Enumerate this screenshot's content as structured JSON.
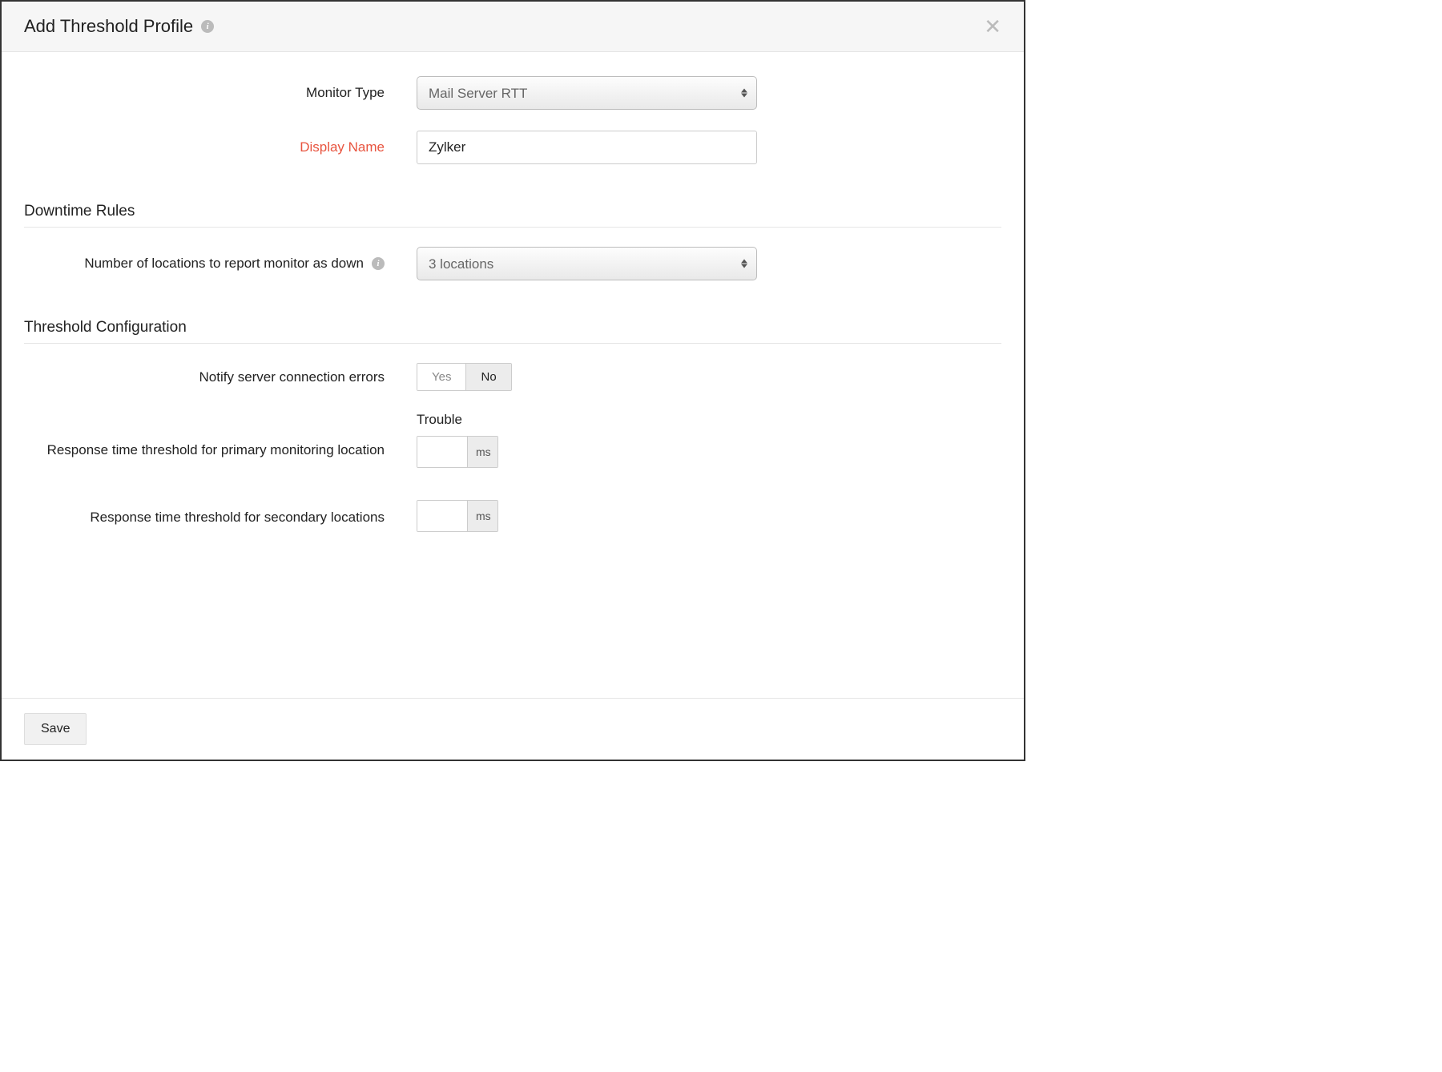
{
  "header": {
    "title": "Add Threshold Profile"
  },
  "form": {
    "monitor_type_label": "Monitor Type",
    "monitor_type_value": "Mail Server RTT",
    "display_name_label": "Display Name",
    "display_name_value": "Zylker"
  },
  "downtime": {
    "section_title": "Downtime Rules",
    "locations_label": "Number of locations to report monitor as down",
    "locations_value": "3 locations"
  },
  "threshold": {
    "section_title": "Threshold Configuration",
    "notify_label": "Notify server connection errors",
    "toggle_yes": "Yes",
    "toggle_no": "No",
    "toggle_selected": "No",
    "trouble_header": "Trouble",
    "primary_label": "Response time threshold for primary monitoring location",
    "secondary_label": "Response time threshold for secondary locations",
    "primary_value": "",
    "secondary_value": "",
    "unit": "ms"
  },
  "footer": {
    "save_label": "Save"
  }
}
